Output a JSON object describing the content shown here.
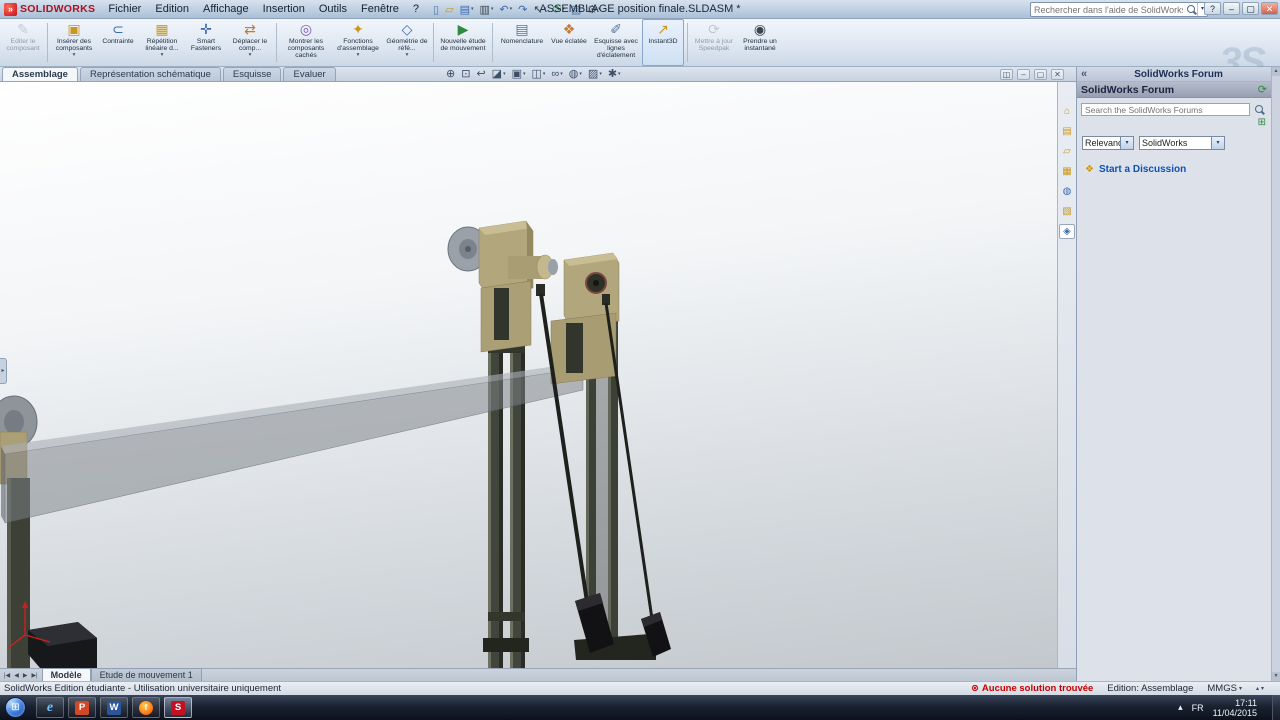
{
  "window": {
    "brand": "SOLIDWORKS",
    "brand_glyph": "»",
    "title": "ASSEMBLAGE position finale.SLDASM *",
    "search_placeholder": "Rechercher dans l'aide de SolidWorks",
    "watermark": "3S"
  },
  "glyphs": {
    "dropdown": "▾"
  },
  "win_controls": {
    "help": "?",
    "min": "–",
    "max": "▢",
    "close": "✕"
  },
  "menus": [
    "Fichier",
    "Edition",
    "Affichage",
    "Insertion",
    "Outils",
    "Fenêtre",
    "?"
  ],
  "quickbar": [
    {
      "name": "new-file",
      "glyph": "▯"
    },
    {
      "name": "open-file",
      "glyph": "▱"
    },
    {
      "name": "save",
      "glyph": "▤"
    },
    {
      "name": "print",
      "glyph": "▥"
    },
    {
      "name": "undo",
      "glyph": "↶"
    },
    {
      "name": "redo",
      "glyph": "↷"
    },
    {
      "name": "select",
      "glyph": "↖"
    },
    {
      "name": "rebuild",
      "glyph": "⟳"
    },
    {
      "name": "file-properties",
      "glyph": "▧"
    },
    {
      "name": "options",
      "glyph": "⚙"
    }
  ],
  "ribbon": {
    "buttons": [
      {
        "label": "Editer le composant",
        "glyph": "✎"
      },
      {
        "label": "Insérer des composants",
        "glyph": "▣"
      },
      {
        "label": "Contrainte",
        "glyph": "⊂"
      },
      {
        "label": "Répétition linéaire d...",
        "glyph": "▦"
      },
      {
        "label": "Smart Fasteners",
        "glyph": "✛"
      },
      {
        "label": "Déplacer le comp...",
        "glyph": "⇄"
      },
      {
        "label": "Montrer les composants cachés",
        "glyph": "◎"
      },
      {
        "label": "Fonctions d'assemblage",
        "glyph": "✦"
      },
      {
        "label": "Géométrie de réfé...",
        "glyph": "◇"
      },
      {
        "label": "Nouvelle étude de mouvement",
        "glyph": "▶"
      },
      {
        "label": "Nomenclature",
        "glyph": "▤"
      },
      {
        "label": "Vue éclatée",
        "glyph": "❖"
      },
      {
        "label": "Esquisse avec lignes d'éclatement",
        "glyph": "✐"
      },
      {
        "label": "Instant3D",
        "glyph": "↗"
      },
      {
        "label": "Mettre à jour Speedpak",
        "glyph": "⟳"
      },
      {
        "label": "Prendre un instantané",
        "glyph": "◉"
      }
    ]
  },
  "tabs": [
    {
      "label": "Assemblage"
    },
    {
      "label": "Représentation schématique"
    },
    {
      "label": "Esquisse"
    },
    {
      "label": "Evaluer"
    }
  ],
  "headsup": [
    {
      "name": "zoom-fit",
      "glyph": "⊕"
    },
    {
      "name": "zoom-area",
      "glyph": "⊡"
    },
    {
      "name": "previous-view",
      "glyph": "↩"
    },
    {
      "name": "section-view",
      "glyph": "◪"
    },
    {
      "name": "view-orientation",
      "glyph": "▣"
    },
    {
      "name": "display-style",
      "glyph": "◫"
    },
    {
      "name": "hide-show-items",
      "glyph": "∞"
    },
    {
      "name": "edit-appearance",
      "glyph": "◍"
    },
    {
      "name": "apply-scene",
      "glyph": "▨"
    },
    {
      "name": "view-settings",
      "glyph": "✱"
    }
  ],
  "docwin": [
    "◫",
    "–",
    "▢",
    "✕"
  ],
  "viewport": {
    "flyout_glyph": "▸"
  },
  "pane_tabs": [
    {
      "name": "solidworks-resources",
      "glyph": "⌂"
    },
    {
      "name": "design-library",
      "glyph": "▤"
    },
    {
      "name": "file-explorer",
      "glyph": "▱"
    },
    {
      "name": "view-palette",
      "glyph": "▦"
    },
    {
      "name": "appearances-scenes",
      "glyph": "◍"
    },
    {
      "name": "custom-properties",
      "glyph": "▧"
    },
    {
      "name": "solidworks-forum",
      "glyph": "◈"
    }
  ],
  "taskpane": {
    "collapse_glyph": "«",
    "title": "SolidWorks Forum",
    "header": "SolidWorks Forum",
    "refresh_glyph": "⟳",
    "search_placeholder": "Search the SolidWorks Forums",
    "add_glyph": "⊞",
    "sort_value": "Relevance",
    "scope_value": "SolidWorks",
    "discussion_icon": "❖",
    "discussion_label": "Start a Discussion",
    "scroll_up": "▲",
    "scroll_down": "▼"
  },
  "model_tabs": {
    "nav": [
      "|◀",
      "◀",
      "▶",
      "▶|"
    ],
    "tabs": [
      {
        "label": "Modèle"
      },
      {
        "label": "Etude de mouvement 1"
      }
    ]
  },
  "statusbar": {
    "left": "SolidWorks Edition étudiante - Utilisation universitaire uniquement",
    "warning_icon": "⊗",
    "warning": "Aucune solution trouvée",
    "mode": "Edition: Assemblage",
    "units": "MMGS",
    "expand_up": "▴",
    "expand_down": "▾"
  },
  "taskbar": {
    "start_glyph": "⊞",
    "apps": [
      {
        "name": "Internet Explorer",
        "letter": "e"
      },
      {
        "name": "PowerPoint",
        "letter": "P"
      },
      {
        "name": "Word",
        "letter": "W"
      },
      {
        "name": "Firefox",
        "letter": "f"
      },
      {
        "name": "SolidWorks",
        "letter": "S"
      }
    ],
    "tray_hidden_glyph": "▴",
    "lang": "FR",
    "time": "17:11",
    "date": "11/04/2015"
  },
  "colors": {
    "accent_red": "#c41020",
    "titlebar_blue": "#b9cde2",
    "viewport_top": "#ffffff",
    "viewport_bottom": "#c3c8cd",
    "panel_bg": "#dde1ea",
    "warning_red": "#cc0000",
    "link_blue": "#1050b0",
    "rail_olive": "#41453c",
    "bracket_tan": "#b2a67c",
    "beam_gray": "rgba(127,132,138,0.52)",
    "taskbar_dark": "#141a26"
  }
}
